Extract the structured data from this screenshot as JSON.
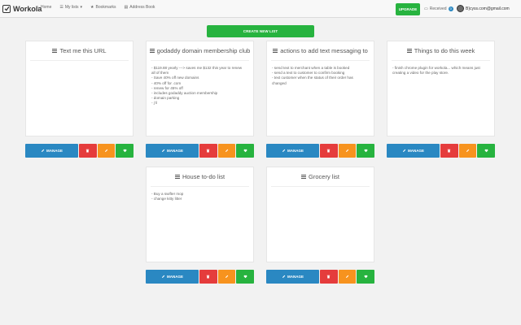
{
  "nav": {
    "brand": "Workola",
    "links": [
      {
        "label": "Home",
        "icon": "home-icon",
        "glyph": "⌂"
      },
      {
        "label": "My lists",
        "icon": "list-icon",
        "glyph": "☰",
        "caret": "▾"
      },
      {
        "label": "Bookmarks",
        "icon": "bookmark-icon",
        "glyph": "★"
      },
      {
        "label": "Address Book",
        "icon": "book-icon",
        "glyph": "▤"
      }
    ],
    "upgrade_label": "UPGRADE",
    "received_label": "Received",
    "received_count": "0",
    "user_email": "B}cyss.com@gmail.com"
  },
  "create_button_label": "CREATE NEW LIST",
  "action_labels": {
    "manage": "MANAGE"
  },
  "colors": {
    "green": "#27b33f",
    "blue": "#2a88c2",
    "red": "#e53c3c",
    "orange": "#f7931e"
  },
  "lists": [
    {
      "title": "Text me this URL",
      "lines": []
    },
    {
      "title": "godaddy domain membership club",
      "lines": [
        "- $119.88 yearly ---> saves me $132 this year to renew",
        "all of them",
        "- Save 40% off new domains",
        "- 40% off for .com",
        "- renew for 45% off",
        "- includes godaddy auction membership",
        "- domain parking",
        "- j'il"
      ]
    },
    {
      "title": "actions to add text messaging to",
      "lines": [
        "- send text to merchant when a table is booked",
        "- send a text to customer to confirm booking",
        "- text customer when the status of their order has",
        "changed"
      ]
    },
    {
      "title": "Things to do this week",
      "lines": [
        "- finish chrome plugin for workola... which means just",
        "creating a video for the play store."
      ]
    },
    {
      "title": "House to-do list",
      "lines": [
        "- Buy a swifter mop",
        "- change kitty litter"
      ]
    },
    {
      "title": "Grocery list",
      "lines": []
    }
  ]
}
